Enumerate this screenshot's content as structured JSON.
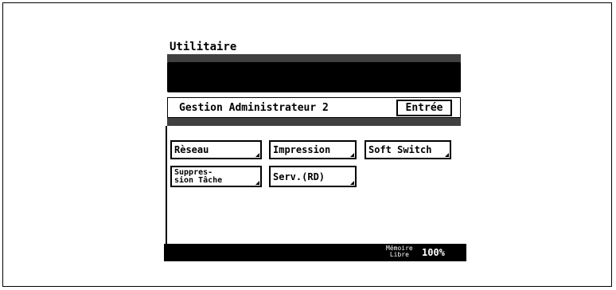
{
  "screen": {
    "title": "Utilitaire",
    "section_title": "Gestion Administrateur 2",
    "enter_label": "Entrée"
  },
  "buttons": [
    {
      "label": "Rèseau"
    },
    {
      "label": "Impression"
    },
    {
      "label": "Soft Switch"
    },
    {
      "label_line1": "Suppres-",
      "label_line2": "sion Tâche"
    },
    {
      "label": "Serv.(RD)"
    }
  ],
  "status": {
    "memory_label_line1": "Mémoire",
    "memory_label_line2": "Libre",
    "memory_value": "100%"
  },
  "colors": {
    "foreground": "#000000",
    "background": "#ffffff"
  }
}
